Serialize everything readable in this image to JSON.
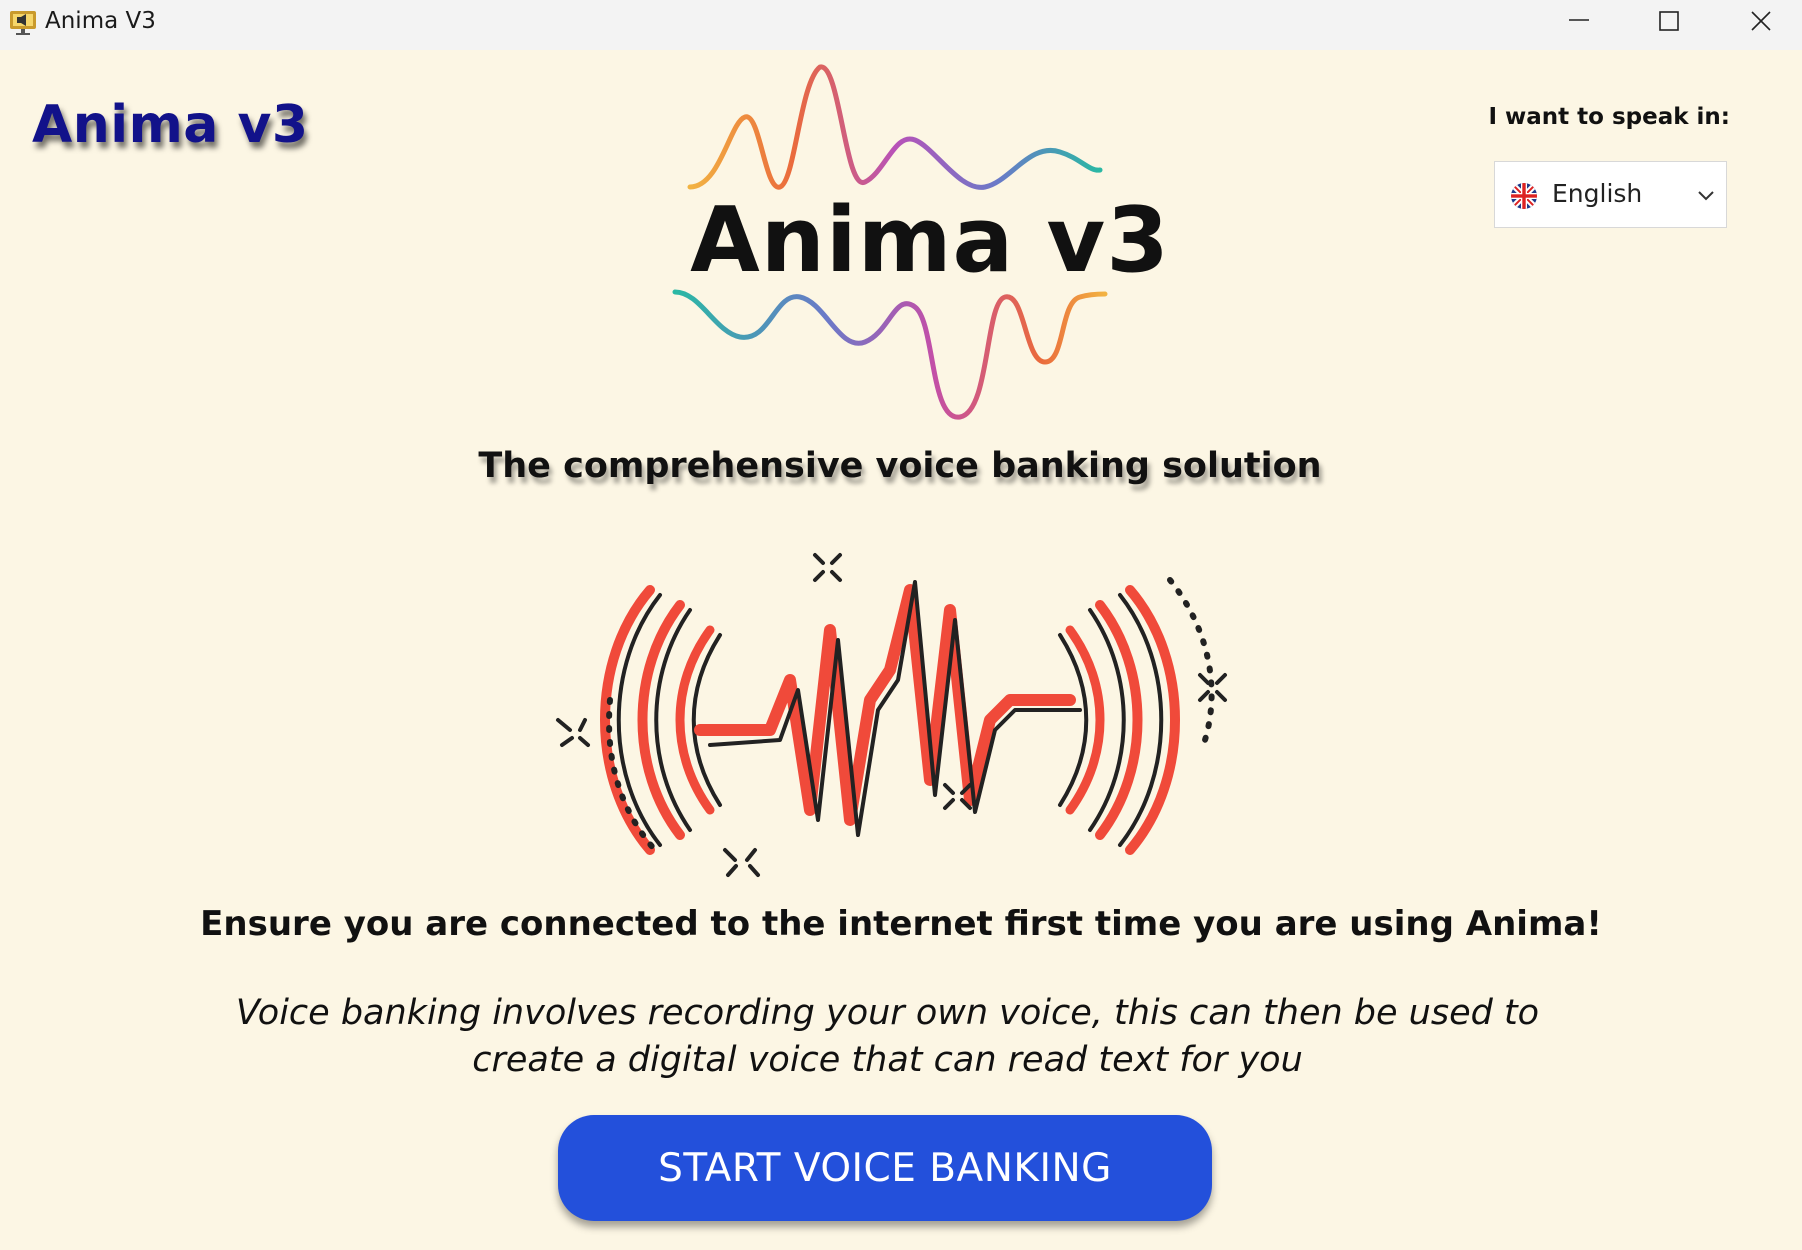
{
  "window": {
    "title": "Anima V3",
    "icon": "app-monitor-speaker-icon",
    "controls": [
      "minimize-icon",
      "maximize-icon",
      "close-icon"
    ]
  },
  "brand": {
    "title": "Anima v3",
    "color": "#12128a"
  },
  "logo": {
    "text": "Anima v3",
    "icon": "sound-wave-logo"
  },
  "tagline": "The comprehensive voice banking solution",
  "language": {
    "label": "I want to speak in:",
    "selected": "English",
    "flag_icon": "uk-flag-icon"
  },
  "illustration": {
    "icon": "voice-waveform-illustration",
    "accent": "#f04a3a"
  },
  "notice": "Ensure you are connected to the internet first time you are using Anima!",
  "description": "Voice banking involves recording your own voice, this can then be used to create a digital voice that can read text for you",
  "start_button": {
    "label": "START VOICE BANKING",
    "color": "#2350db"
  },
  "background": "#fcf6e4"
}
